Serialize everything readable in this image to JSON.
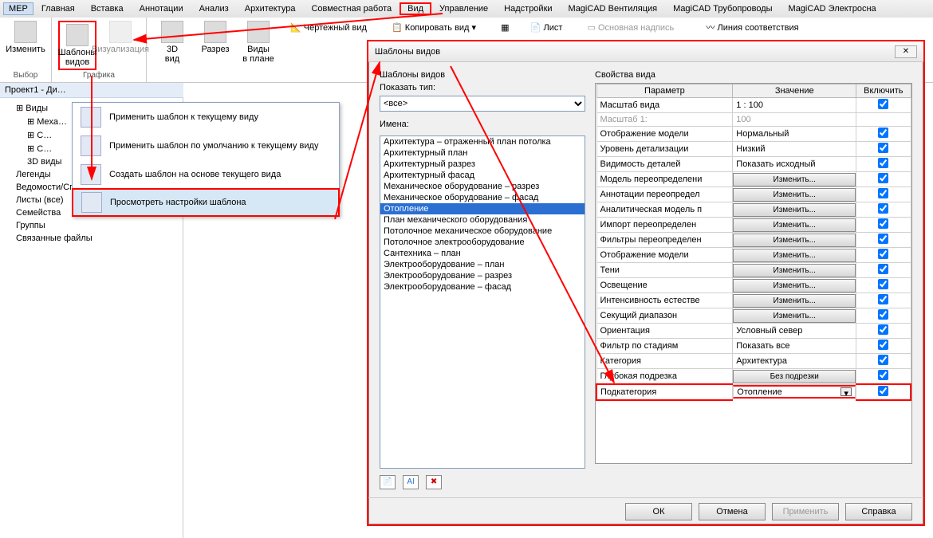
{
  "menu": [
    "MEP",
    "Главная",
    "Вставка",
    "Аннотации",
    "Анализ",
    "Архитектура",
    "Совместная работа",
    "Вид",
    "Управление",
    "Надстройки",
    "MagiCAD Вентиляция",
    "MagiCAD Трубопроводы",
    "MagiCAD Электросна"
  ],
  "ribbon": {
    "edit": "Изменить",
    "templates": "Шаблоны\nвидов",
    "viz": "Визуализация",
    "v3d": "3D\nвид",
    "section": "Разрез",
    "plans": "Виды\nв плане",
    "g1": "Выбор",
    "g2": "Графика"
  },
  "mid": {
    "l1": "Чертежный вид",
    "l2": "Копировать вид ▾",
    "r1": "Лист",
    "r2": "Основная надпись",
    "r3": "Линия соответствия"
  },
  "treeHdr": "Проект1 - Ди…",
  "tree": [
    "Виды",
    "Meха…",
    "С…",
    "С…",
    "3D виды",
    "Легенды",
    "Ведомости/Спецификации",
    "Листы (все)",
    "Семейства",
    "Группы",
    "Связанные файлы"
  ],
  "dropdown": [
    "Применить шаблон к текущему виду",
    "Применить шаблон по умолчанию к текущему виду",
    "Создать шаблон на основе текущего вида",
    "Просмотреть настройки шаблона"
  ],
  "dlg": {
    "title": "Шаблоны видов",
    "leftHdr": "Шаблоны видов",
    "rightHdr": "Свойства вида",
    "showType": "Показать тип:",
    "allOpt": "<все>",
    "namesLbl": "Имена:",
    "names": [
      "Архитектура – отраженный план потолка",
      "Архитектурный план",
      "Архитектурный разрез",
      "Архитектурный фасад",
      "Механическое оборудование – разрез",
      "Механическое оборудование – фасад",
      "Отопление",
      "План механического оборудования",
      "Потолочное механическое оборудование",
      "Потолочное электрооборудование",
      "Сантехника – план",
      "Электрооборудование – план",
      "Электрооборудование – разрез",
      "Электрооборудование – фасад"
    ],
    "cols": [
      "Параметр",
      "Значение",
      "Включить"
    ],
    "btns": {
      "ok": "ОК",
      "cancel": "Отмена",
      "apply": "Применить",
      "help": "Справка"
    },
    "rows": [
      {
        "p": "Масштаб вида",
        "v": "1 : 100",
        "chk": true
      },
      {
        "p": "Масштаб  1:",
        "v": "100",
        "dis": true
      },
      {
        "p": "Отображение модели",
        "v": "Нормальный",
        "chk": true
      },
      {
        "p": "Уровень детализации",
        "v": "Низкий",
        "chk": true
      },
      {
        "p": "Видимость деталей",
        "v": "Показать исходный",
        "chk": true
      },
      {
        "p": "Модель переопределени",
        "btn": "Изменить...",
        "chk": true
      },
      {
        "p": "Аннотации переопредел",
        "btn": "Изменить...",
        "chk": true
      },
      {
        "p": "Аналитическая модель п",
        "btn": "Изменить...",
        "chk": true
      },
      {
        "p": "Импорт переопределен",
        "btn": "Изменить...",
        "chk": true
      },
      {
        "p": "Фильтры переопределен",
        "btn": "Изменить...",
        "chk": true
      },
      {
        "p": "Отображение модели",
        "btn": "Изменить...",
        "chk": true
      },
      {
        "p": "Тени",
        "btn": "Изменить...",
        "chk": true
      },
      {
        "p": "Освещение",
        "btn": "Изменить...",
        "chk": true
      },
      {
        "p": "Интенсивность естестве",
        "btn": "Изменить...",
        "chk": true
      },
      {
        "p": "Секущий диапазон",
        "btn": "Изменить...",
        "chk": true
      },
      {
        "p": "Ориентация",
        "v": "Условный север",
        "chk": true
      },
      {
        "p": "Фильтр по стадиям",
        "v": "Показать все",
        "chk": true
      },
      {
        "p": "Категория",
        "v": "Архитектура",
        "chk": true
      },
      {
        "p": "Глубокая подрезка",
        "btn": "Без подрезки",
        "chk": true
      },
      {
        "p": "Подкатегория",
        "v": "Отопление",
        "chk": true,
        "redbox": true,
        "combo": true
      }
    ]
  }
}
